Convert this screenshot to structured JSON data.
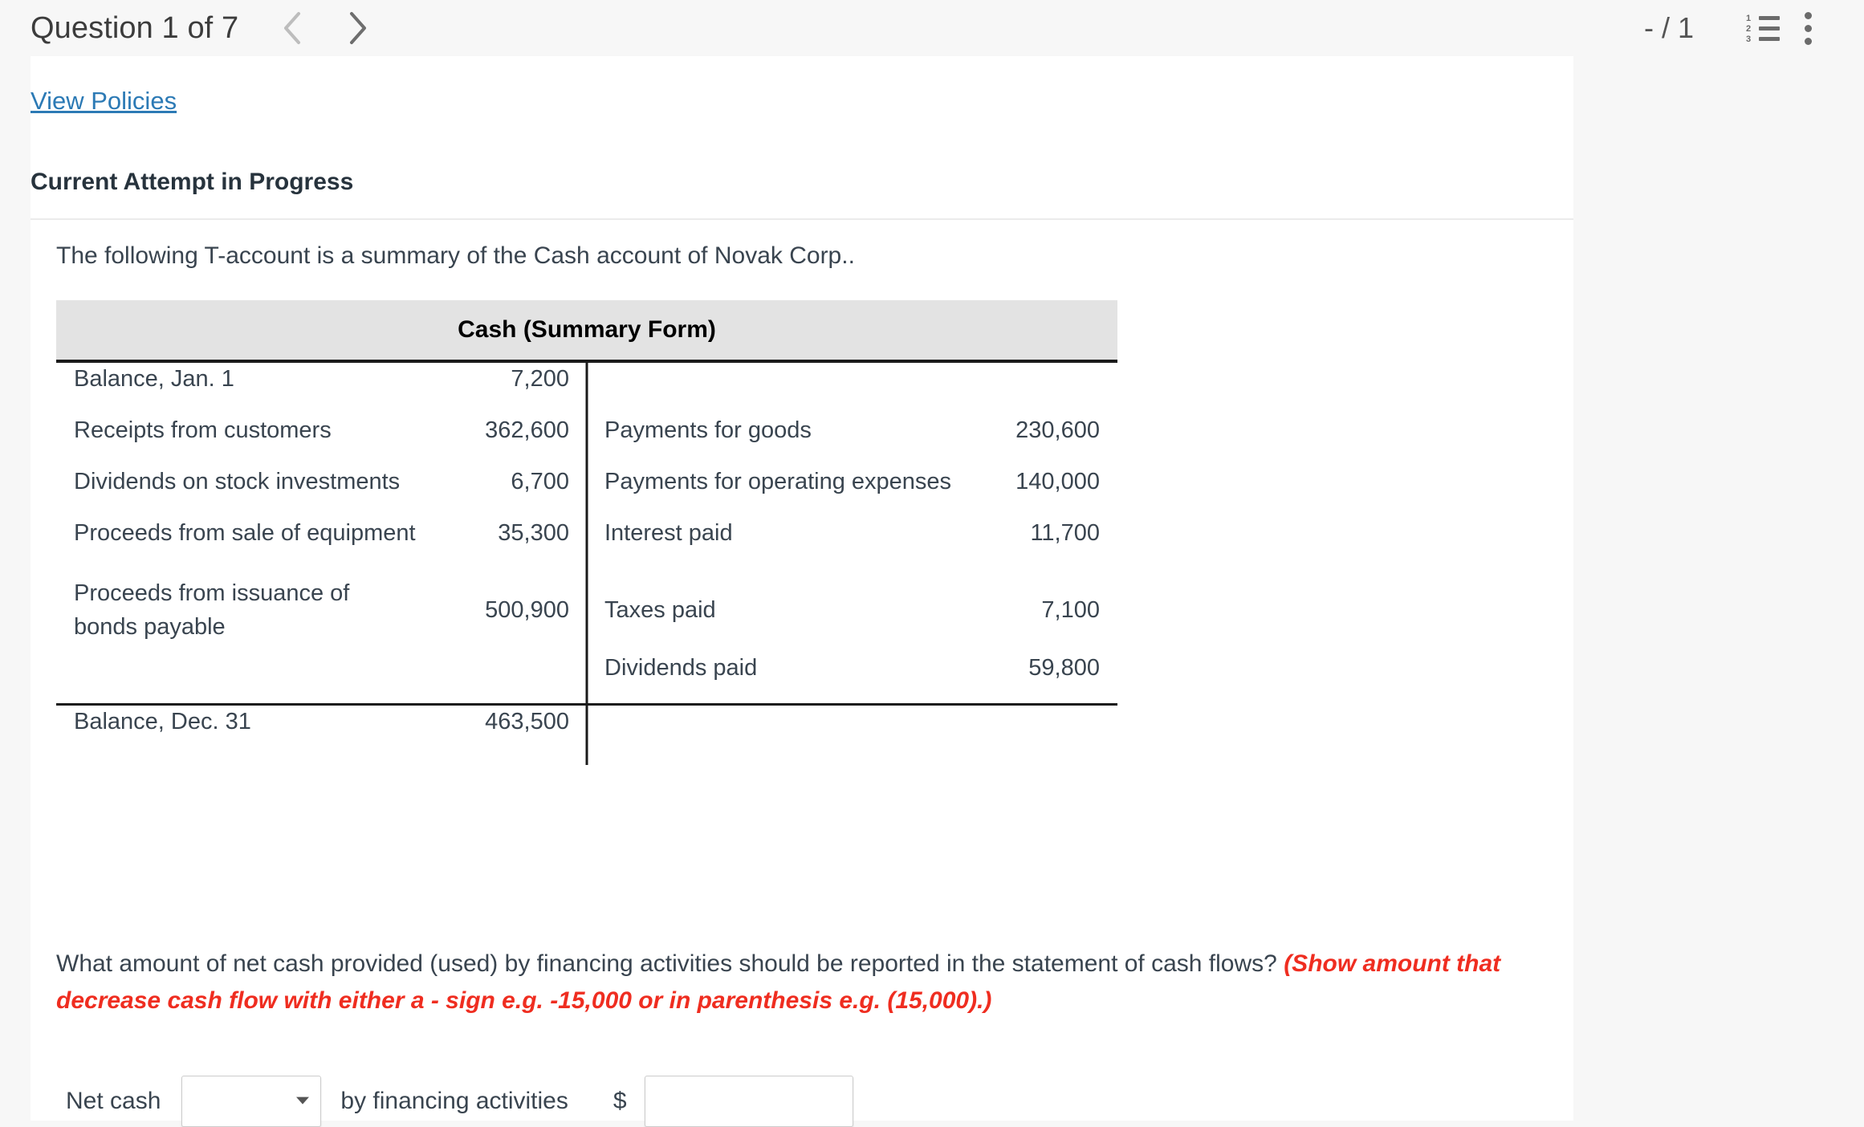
{
  "header": {
    "question_title": "Question 1 of 7",
    "prev_icon": "chevron-left-icon",
    "next_icon": "chevron-right-icon",
    "score": "- / 1",
    "list_icon": "numbered-list-icon",
    "list_icon_numbers": [
      "1",
      "2",
      "3"
    ],
    "menu_icon": "kebab-menu-icon"
  },
  "card": {
    "view_policies_link": "View Policies",
    "attempt_status": "Current Attempt in Progress",
    "intro_text": "The following T-account is a summary of the Cash account of Novak Corp.."
  },
  "taccount": {
    "title": "Cash (Summary Form)",
    "debits": [
      {
        "label": "Balance, Jan. 1",
        "value": "7,200"
      },
      {
        "label": "Receipts from customers",
        "value": "362,600"
      },
      {
        "label": "Dividends on stock investments",
        "value": "6,700"
      },
      {
        "label": "Proceeds from sale of equipment",
        "value": "35,300"
      },
      {
        "label": "Proceeds from issuance of\n   bonds payable",
        "value": "500,900"
      }
    ],
    "credits": [
      {
        "label": "Payments for goods",
        "value": "230,600"
      },
      {
        "label": "Payments for operating expenses",
        "value": "140,000"
      },
      {
        "label": "Interest paid",
        "value": "11,700"
      },
      {
        "label": "Taxes paid",
        "value": "7,100"
      },
      {
        "label": "Dividends paid",
        "value": "59,800"
      }
    ],
    "footer": {
      "label": "Balance, Dec. 31",
      "value": "463,500"
    }
  },
  "question": {
    "main_text": "What amount of net cash provided (used) by financing activities should be reported in the statement of cash flows? ",
    "hint_text": "(Show amount that decrease cash flow with either a - sign e.g. -15,000 or in parenthesis e.g. (15,000).)",
    "hint_color": "#ef2d20"
  },
  "answer": {
    "prefix_label": "Net cash",
    "dropdown_value": "",
    "middle_label": "by financing activities",
    "currency_symbol": "$",
    "amount_value": ""
  },
  "colors": {
    "link": "#2c7ab5",
    "text": "#39444f",
    "table_header_bg": "#e3e3e3",
    "page_bg": "#f7f7f7",
    "card_bg": "#ffffff"
  }
}
